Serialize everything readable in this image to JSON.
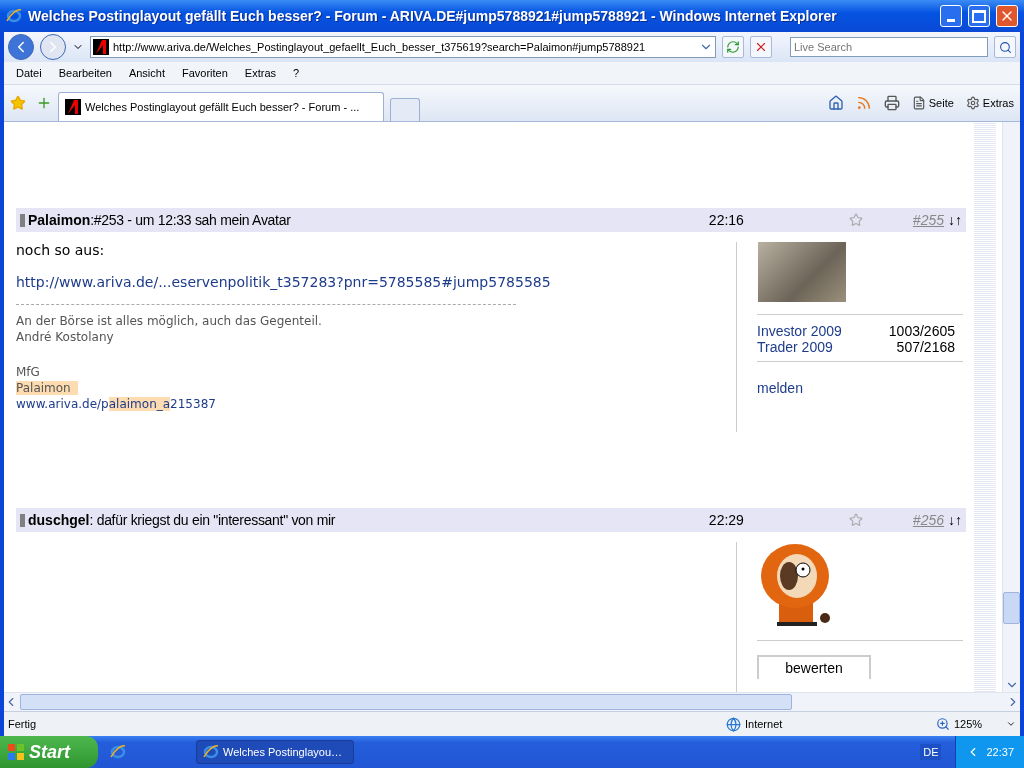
{
  "window": {
    "title": "Welches Postinglayout gefällt Euch besser? - Forum - ARIVA.DE#jump5788921#jump5788921 - Windows Internet Explorer"
  },
  "address": {
    "url": "http://www.ariva.de/Welches_Postinglayout_gefaellt_Euch_besser_t375619?search=Palaimon#jump5788921"
  },
  "search": {
    "placeholder": "Live Search"
  },
  "menu": [
    "Datei",
    "Bearbeiten",
    "Ansicht",
    "Favoriten",
    "Extras",
    "?"
  ],
  "tab": {
    "title": "Welches Postinglayout gefällt Euch besser? - Forum - ..."
  },
  "commands": [
    "Seite",
    "Extras"
  ],
  "posts": [
    {
      "author": "Palaimon",
      "subject": ":#253 - um 12:33 sah mein Avatar",
      "time": "22:16",
      "number": "#255",
      "nav": "↓↑",
      "avatar": {
        "kind": "photo"
      },
      "body": [
        "noch so aus:"
      ],
      "link": "http://www.ariva.de/...eservenpolitik_t357283?pnr=5785585#jump5785585",
      "signature": [
        "An der Börse ist alles möglich, auch das Gegenteil.",
        "André Kostolany"
      ],
      "greeting": "MfG",
      "name": "Palaimon",
      "sig_link": [
        {
          "text": "www.ariva.de/p",
          "highlighted": false
        },
        {
          "text": "alaimon_a",
          "highlighted": true
        },
        {
          "text": "215387",
          "highlighted": false
        }
      ],
      "stats": [
        {
          "label": "Investor 2009",
          "value": "1003/2605"
        },
        {
          "label": "Trader 2009",
          "value": "507/2168"
        }
      ],
      "action": {
        "kind": "link",
        "label": "melden"
      }
    },
    {
      "author": "duschgel",
      "subject": ": dafür kriegst du ein \"interessant\" von mir",
      "time": "22:29",
      "number": "#256",
      "nav": "↓↑",
      "avatar": {
        "kind": "cartoon"
      },
      "action": {
        "kind": "button",
        "label": "bewerten"
      }
    }
  ],
  "status": {
    "text": "Fertig",
    "zone": "Internet",
    "zoom": "125%"
  },
  "taskbar": {
    "start": "Start",
    "task": "Welches Postinglayou…",
    "language": "DE",
    "clock": "22:37"
  }
}
